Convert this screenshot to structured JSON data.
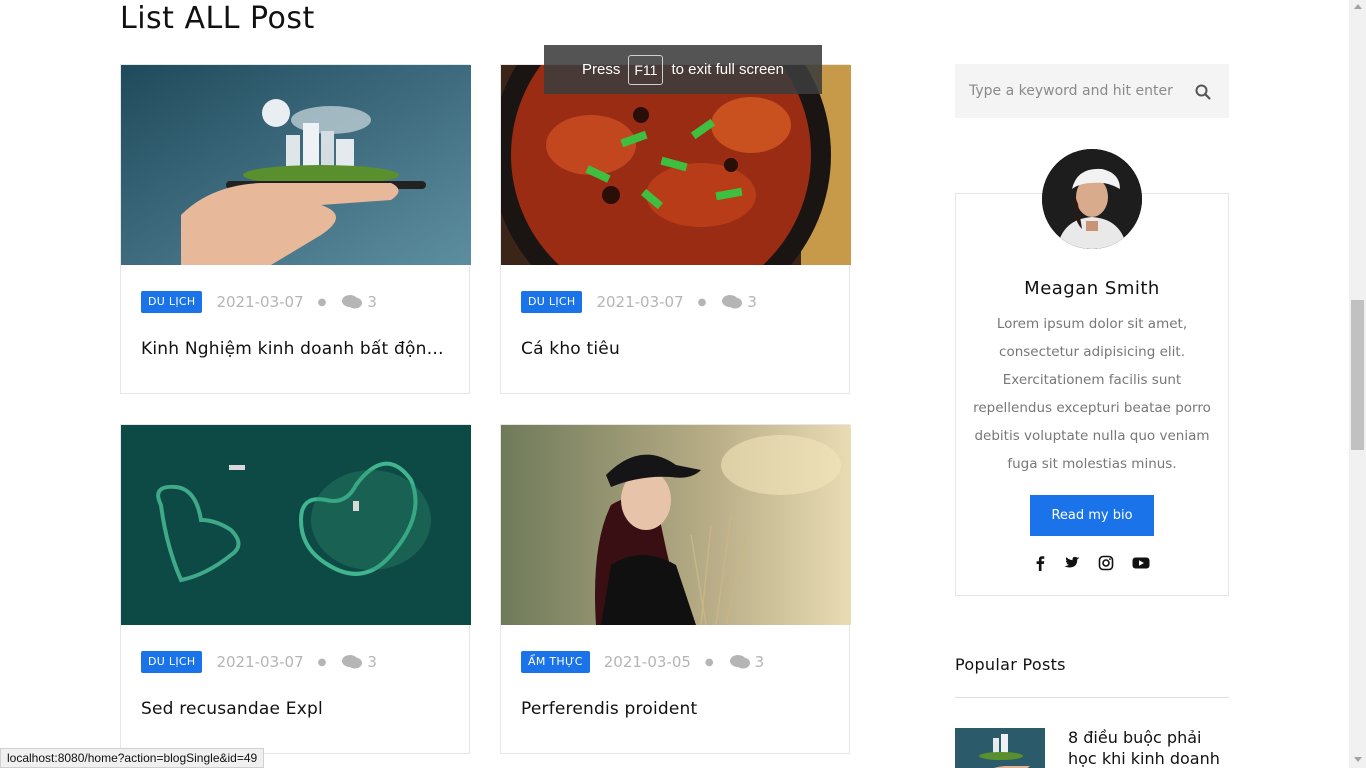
{
  "page": {
    "title": "List ALL Post"
  },
  "fullscreen_notice": {
    "prefix": "Press",
    "key": "F11",
    "suffix": "to exit full screen"
  },
  "posts": [
    {
      "category": "DU LỊCH",
      "date": "2021-03-07",
      "comments": "3",
      "title": "Kinh Nghiệm kinh doanh bất động s..."
    },
    {
      "category": "DU LỊCH",
      "date": "2021-03-07",
      "comments": "3",
      "title": "Cá kho tiêu"
    },
    {
      "category": "DU LỊCH",
      "date": "2021-03-07",
      "comments": "3",
      "title": "Sed recusandae Expl"
    },
    {
      "category": "ẨM THỰC",
      "date": "2021-03-05",
      "comments": "3",
      "title": "Perferendis proident"
    }
  ],
  "sidebar": {
    "search": {
      "placeholder": "Type a keyword and hit enter"
    },
    "bio": {
      "name": "Meagan Smith",
      "text": "Lorem ipsum dolor sit amet, consectetur adipisicing elit. Exercitationem facilis sunt repellendus excepturi beatae porro debitis voluptate nulla quo veniam fuga sit molestias minus.",
      "button": "Read my bio",
      "social": [
        "facebook-icon",
        "twitter-icon",
        "instagram-icon",
        "youtube-icon"
      ]
    },
    "popular": {
      "heading": "Popular Posts",
      "items": [
        {
          "title": "8 điều buộc phải học khi kinh doanh"
        }
      ]
    }
  },
  "status_bar": {
    "url": "localhost:8080/home?action=blogSingle&id=49"
  },
  "colors": {
    "accent": "#1a73e8",
    "muted": "#b5b5b5"
  }
}
